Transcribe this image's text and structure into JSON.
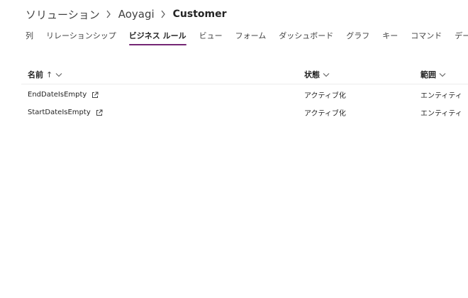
{
  "breadcrumb": {
    "items": [
      "ソリューション",
      "Aoyagi",
      "Customer"
    ]
  },
  "tabs": [
    {
      "label": "列",
      "active": false
    },
    {
      "label": "リレーションシップ",
      "active": false
    },
    {
      "label": "ビジネス ルール",
      "active": true
    },
    {
      "label": "ビュー",
      "active": false
    },
    {
      "label": "フォーム",
      "active": false
    },
    {
      "label": "ダッシュボード",
      "active": false
    },
    {
      "label": "グラフ",
      "active": false
    },
    {
      "label": "キー",
      "active": false
    },
    {
      "label": "コマンド",
      "active": false
    },
    {
      "label": "データ",
      "active": false
    }
  ],
  "grid": {
    "columns": {
      "name": "名前",
      "status": "状態",
      "scope": "範囲"
    },
    "sort_indicator": "↑",
    "rows": [
      {
        "name": "EndDateIsEmpty",
        "status": "アクティブ化",
        "scope": "エンティティ"
      },
      {
        "name": "StartDateIsEmpty",
        "status": "アクティブ化",
        "scope": "エンティティ"
      }
    ]
  },
  "colors": {
    "accent": "#742774",
    "text": "#242424",
    "divider": "#ececec"
  }
}
